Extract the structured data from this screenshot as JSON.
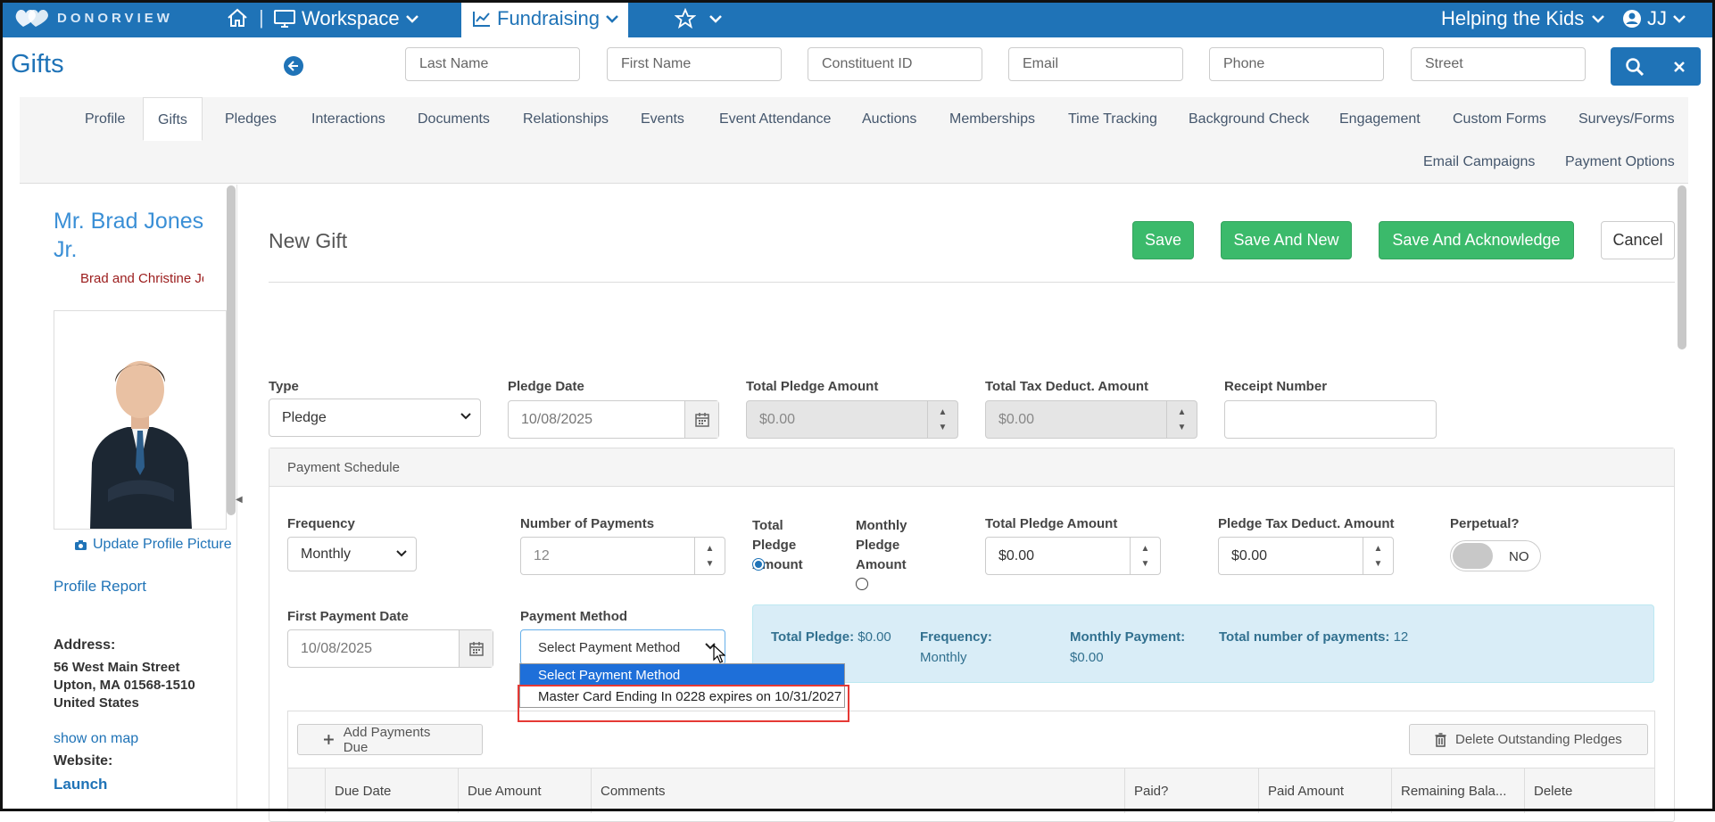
{
  "nav": {
    "logo_text": "DONORVIEW",
    "separator": "|",
    "workspace": "Workspace",
    "fundraising": "Fundraising",
    "org": "Helping the Kids",
    "user": "JJ"
  },
  "header": {
    "title": "Gifts",
    "search": {
      "last_name": "Last Name",
      "first_name": "First Name",
      "constituent_id": "Constituent ID",
      "email": "Email",
      "phone": "Phone",
      "street": "Street"
    }
  },
  "tabs": {
    "row1": [
      "Profile",
      "Gifts",
      "Pledges",
      "Interactions",
      "Documents",
      "Relationships",
      "Events",
      "Event Attendance",
      "Auctions",
      "Memberships",
      "Time Tracking",
      "Background Check",
      "Engagement",
      "Custom Forms",
      "Surveys/Forms"
    ],
    "row2": [
      "Email Campaigns",
      "Payment Options"
    ],
    "active": "Gifts"
  },
  "profile": {
    "name": "Mr. Brad Jones Jr.",
    "household": "Brad and Christine Jones",
    "update_picture": "Update Profile Picture",
    "report": "Profile Report",
    "address_label": "Address:",
    "address_line1": "56 West Main Street",
    "address_line2": "Upton, MA 01568-1510",
    "country": "United States",
    "map_link": "show on map",
    "website_label": "Website:",
    "website_link": "Launch"
  },
  "form": {
    "title": "New Gift",
    "buttons": {
      "save": "Save",
      "save_new": "Save And New",
      "save_ack": "Save And Acknowledge",
      "cancel": "Cancel"
    },
    "type": {
      "label": "Type",
      "value": "Pledge"
    },
    "pledge_date": {
      "label": "Pledge Date",
      "value": "10/08/2025"
    },
    "total_pledge": {
      "label": "Total Pledge Amount",
      "value": "$0.00"
    },
    "total_tax": {
      "label": "Total Tax Deduct. Amount",
      "value": "$0.00"
    },
    "receipt": {
      "label": "Receipt Number",
      "value": ""
    }
  },
  "schedule": {
    "title": "Payment Schedule",
    "frequency": {
      "label": "Frequency",
      "value": "Monthly"
    },
    "num_payments": {
      "label": "Number of Payments",
      "value": "12"
    },
    "radio_total": "Total Pledge Amount",
    "radio_monthly": "Monthly Pledge Amount",
    "pledge_amount": {
      "label": "Total Pledge Amount",
      "value": "$0.00"
    },
    "pledge_tax": {
      "label": "Pledge Tax Deduct. Amount",
      "value": "$0.00"
    },
    "perpetual": {
      "label": "Perpetual?",
      "value": "NO"
    },
    "first_payment": {
      "label": "First Payment Date",
      "value": "10/08/2025"
    },
    "payment_method": {
      "label": "Payment Method",
      "value": "Select Payment Method",
      "options": [
        "Select Payment Method",
        "Master Card Ending In 0228 expires on 10/31/2027"
      ]
    }
  },
  "summary": {
    "total_label": "Total Pledge:",
    "total_value": "$0.00",
    "freq_label": "Frequency:",
    "freq_value": "Monthly",
    "monthly_label": "Monthly Payment:",
    "monthly_value": "$0.00",
    "count_label": "Total number of payments:",
    "count_value": "12"
  },
  "table": {
    "add_button": "Add Payments Due",
    "delete_button": "Delete Outstanding Pledges",
    "columns": [
      "Due Date",
      "Due Amount",
      "Comments",
      "Paid?",
      "Paid Amount",
      "Remaining Bala...",
      "Delete"
    ]
  },
  "colors": {
    "brand_blue": "#1f73b7",
    "save_green": "#3bba6b",
    "summary_bg": "#d9edf7",
    "highlight_red": "#e53935"
  },
  "icons": [
    "home-icon",
    "monitor-icon",
    "trend-icon",
    "star-icon",
    "user-circle-icon",
    "search-icon",
    "close-icon",
    "back-arrow-icon",
    "calendar-icon",
    "camera-icon",
    "plus-icon",
    "trash-icon",
    "chevron-down-icon"
  ]
}
